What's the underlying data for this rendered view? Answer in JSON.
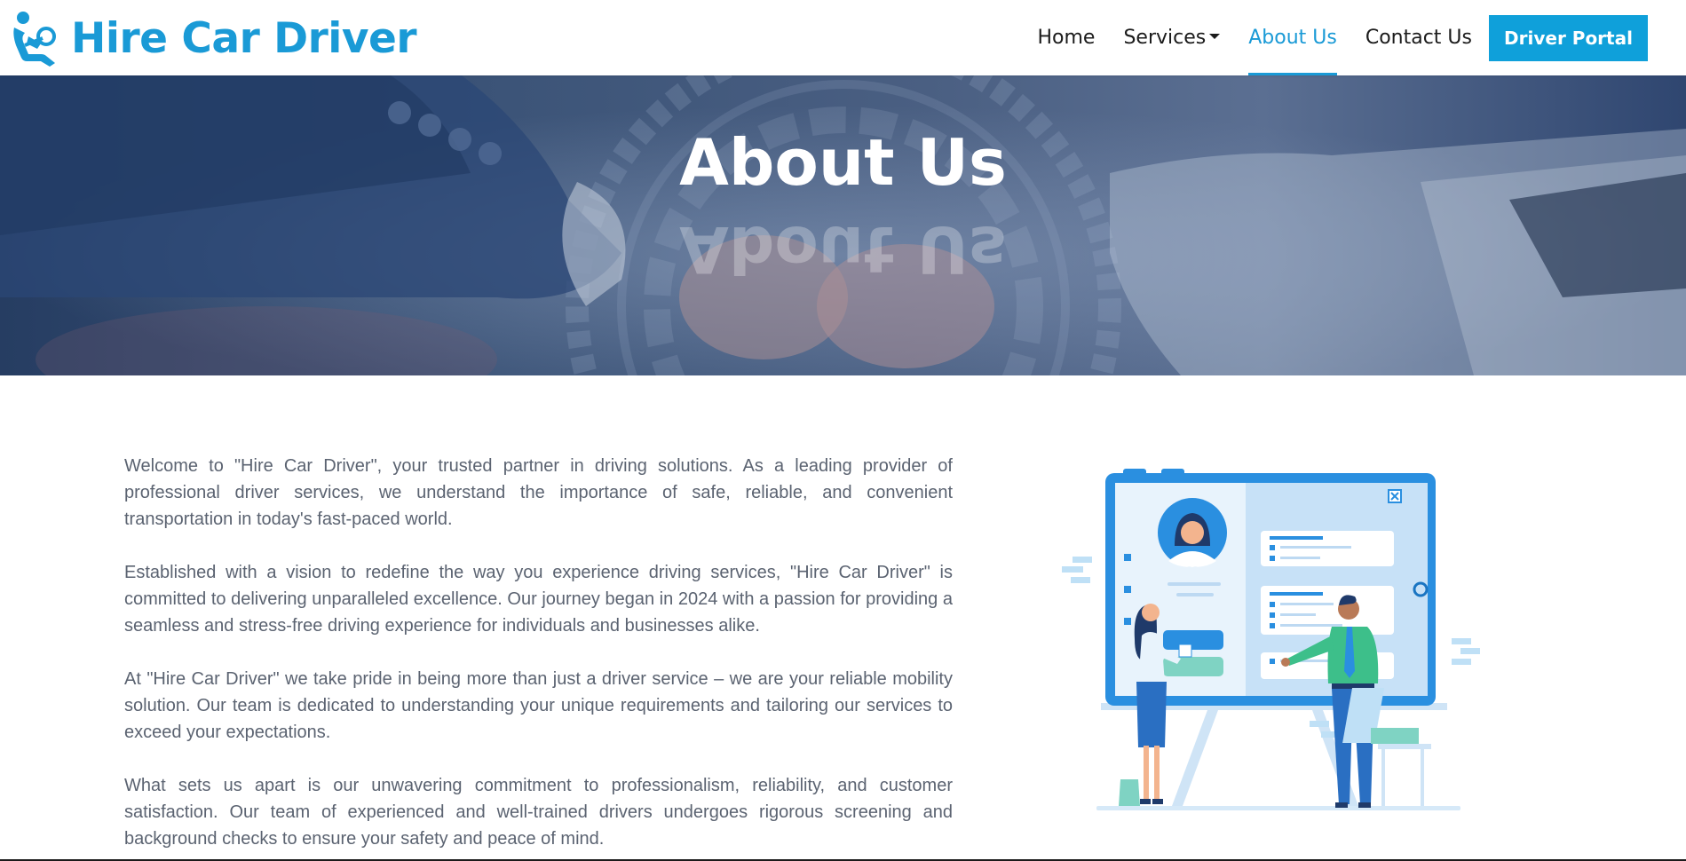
{
  "brand": {
    "name": "Hire Car Driver",
    "icon": "car-seat-driver-icon",
    "color": "#1a9ad6"
  },
  "nav": {
    "items": [
      {
        "label": "Home",
        "active": false
      },
      {
        "label": "Services",
        "active": false,
        "has_dropdown": true
      },
      {
        "label": "About Us",
        "active": true
      },
      {
        "label": "Contact Us",
        "active": false
      }
    ],
    "portal_button": "Driver Portal"
  },
  "hero": {
    "title": "About Us"
  },
  "content": {
    "paragraphs": [
      "Welcome to \"Hire Car Driver\", your trusted partner in driving solutions. As a leading provider of professional driver services, we understand the importance of safe, reliable, and convenient transportation in today's fast-paced world.",
      "Established with a vision to redefine the way you experience driving services, \"Hire Car Driver\" is committed to delivering unparalleled excellence. Our journey began in 2024 with a passion for providing a seamless and stress-free driving experience for individuals and businesses alike.",
      "At \"Hire Car Driver\" we take pride in being more than just a driver service – we are your reliable mobility solution. Our team is dedicated to understanding your unique requirements and tailoring our services to exceed your expectations.",
      "What sets us apart is our unwavering commitment to professionalism, reliability, and customer satisfaction. Our team of experienced and well-trained drivers undergoes rigorous screening and background checks to ensure your safety and peace of mind."
    ]
  },
  "colors": {
    "accent": "#1a9ad6",
    "button": "#0fa0da",
    "text": "#5b6371"
  }
}
